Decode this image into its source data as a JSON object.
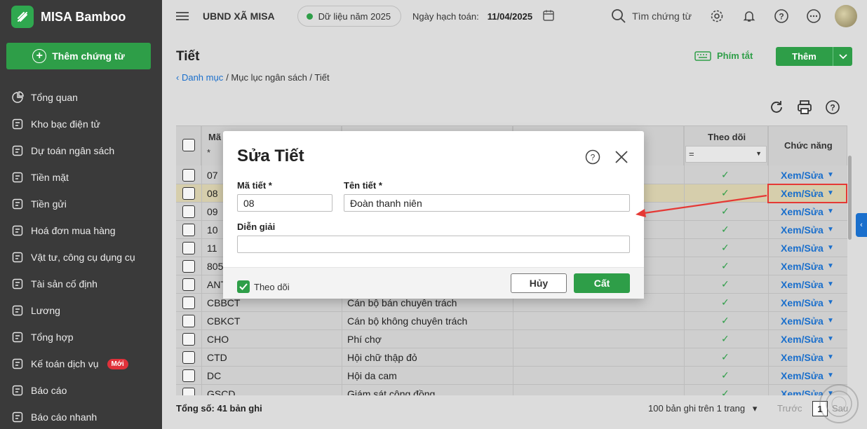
{
  "brand": {
    "name": "MISA Bamboo"
  },
  "sidebar": {
    "add_label": "Thêm chứng từ",
    "items": [
      {
        "label": "Tổng quan",
        "icon": "pie-chart-icon"
      },
      {
        "label": "Kho bạc điện tử",
        "icon": "monitor-icon"
      },
      {
        "label": "Dự toán ngân sách",
        "icon": "budget-icon"
      },
      {
        "label": "Tiền mặt",
        "icon": "cash-icon"
      },
      {
        "label": "Tiền gửi",
        "icon": "deposit-icon"
      },
      {
        "label": "Hoá đơn mua hàng",
        "icon": "invoice-icon"
      },
      {
        "label": "Vật tư, công cụ dụng cụ",
        "icon": "tools-icon"
      },
      {
        "label": "Tài sản cố định",
        "icon": "building-icon"
      },
      {
        "label": "Lương",
        "icon": "salary-icon"
      },
      {
        "label": "Tổng hợp",
        "icon": "summary-icon"
      },
      {
        "label": "Kế toán dịch vụ",
        "icon": "service-icon",
        "badge": "Mới"
      },
      {
        "label": "Báo cáo",
        "icon": "report-icon"
      },
      {
        "label": "Báo cáo nhanh",
        "icon": "quick-report-icon"
      }
    ]
  },
  "topbar": {
    "org": "UBND XÃ MISA",
    "year": "Dữ liệu năm 2025",
    "date_label": "Ngày hạch toán:",
    "date_value": "11/04/2025",
    "search": "Tìm chứng từ"
  },
  "page": {
    "title": "Tiết",
    "breadcrumb_link": "Danh mục",
    "breadcrumb_rest": "/ Mục lục ngân sách / Tiết",
    "hotkey": "Phím tắt",
    "add": "Thêm"
  },
  "table": {
    "headers": {
      "code": "Mã",
      "follow": "Theo dõi",
      "action": "Chức năng"
    },
    "filter_star": "*",
    "filter_eq": "=",
    "action_label": "Xem/Sửa",
    "rows": [
      {
        "code": "07",
        "name": "",
        "follow": true
      },
      {
        "code": "08",
        "name": "",
        "follow": true,
        "selected": true
      },
      {
        "code": "09",
        "name": "",
        "follow": true
      },
      {
        "code": "10",
        "name": "",
        "follow": true
      },
      {
        "code": "11",
        "name": "",
        "follow": true
      },
      {
        "code": "805",
        "name": "",
        "follow": true
      },
      {
        "code": "ANT",
        "name": "",
        "follow": true
      },
      {
        "code": "CBBCT",
        "name": "Cán bộ bán chuyên trách",
        "follow": true
      },
      {
        "code": "CBKCT",
        "name": "Cán bộ không chuyên trách",
        "follow": true
      },
      {
        "code": "CHO",
        "name": "Phí chợ",
        "follow": true
      },
      {
        "code": "CTD",
        "name": "Hội chữ thập đỏ",
        "follow": true
      },
      {
        "code": "DC",
        "name": "Hội da cam",
        "follow": true
      },
      {
        "code": "GSCD",
        "name": "Giám sát cộng đồng",
        "follow": true
      }
    ]
  },
  "footer": {
    "total": "Tổng số: 41 bản ghi",
    "per_page": "100 bản ghi trên 1 trang",
    "prev": "Trước",
    "page": "1",
    "next": "Sau"
  },
  "dialog": {
    "title": "Sửa Tiết",
    "code_label": "Mã tiết *",
    "code_value": "08",
    "name_label": "Tên tiết *",
    "name_value": "Đoàn thanh niên",
    "desc_label": "Diễn giải",
    "desc_value": "",
    "follow_label": "Theo dõi",
    "cancel": "Hủy",
    "save": "Cất"
  },
  "colors": {
    "accent": "#2e9e48",
    "link": "#1a6fcc",
    "sidebar": "#3a3a3a",
    "highlight": "#e53935"
  }
}
